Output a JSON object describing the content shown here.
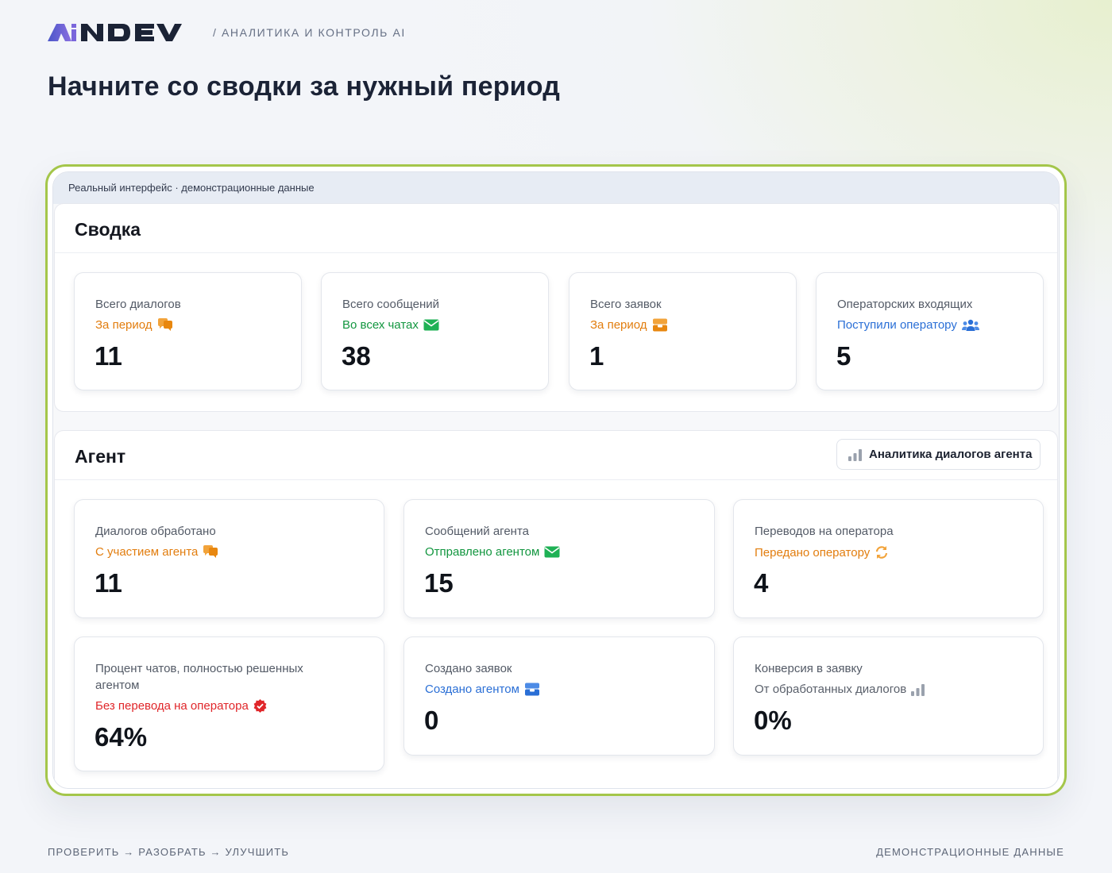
{
  "header": {
    "logo_text": "AiNDEV",
    "tagline": "/ АНАЛИТИКА И КОНТРОЛЬ AI",
    "title": "Начните со сводки за нужный период"
  },
  "app": {
    "strip_text": "Реальный интерфейс · демонстрационные данные",
    "summary": {
      "title": "Сводка",
      "cards": [
        {
          "label": "Всего диалогов",
          "sub": "За период",
          "value": "11",
          "icon": "chat-bubbles-icon",
          "color": "#e27d0e"
        },
        {
          "label": "Всего сообщений",
          "sub": "Во всех чатах",
          "value": "38",
          "icon": "envelope-icon",
          "color": "#12963f"
        },
        {
          "label": "Всего заявок",
          "sub": "За период",
          "value": "1",
          "icon": "inbox-icon",
          "color": "#e27d0e"
        },
        {
          "label": "Операторских входящих",
          "sub": "Поступили оператору",
          "value": "5",
          "icon": "users-icon",
          "color": "#2a6fd6"
        }
      ]
    },
    "agent": {
      "title": "Агент",
      "analytics_button": "Аналитика диалогов агента",
      "cards": [
        {
          "label": "Диалогов обработано",
          "sub": "С участием агента",
          "value": "11",
          "icon": "chat-bubbles-icon",
          "color": "#e27d0e"
        },
        {
          "label": "Сообщений агента",
          "sub": "Отправлено агентом",
          "value": "15",
          "icon": "envelope-icon",
          "color": "#12963f"
        },
        {
          "label": "Переводов на оператора",
          "sub": "Передано оператору",
          "value": "4",
          "icon": "refresh-icon",
          "color": "#e27d0e"
        },
        {
          "label": "Процент чатов, полностью решенных агентом",
          "sub": "Без перевода на оператора",
          "value": "64%",
          "icon": "check-badge-icon",
          "color": "#e0262a"
        },
        {
          "label": "Создано заявок",
          "sub": "Создано агентом",
          "value": "0",
          "icon": "inbox-icon",
          "color": "#2a6fd6"
        },
        {
          "label": "Конверсия в заявку",
          "sub": "От обработанных диалогов",
          "value": "0%",
          "icon": "bar-chart-icon",
          "color": "#5a606b"
        }
      ]
    }
  },
  "footer": {
    "left": "ПРОВЕРИТЬ → РАЗОБРАТЬ → УЛУЧШИТЬ",
    "right": "ДЕМОНСТРАЦИОННЫЕ ДАННЫЕ"
  }
}
